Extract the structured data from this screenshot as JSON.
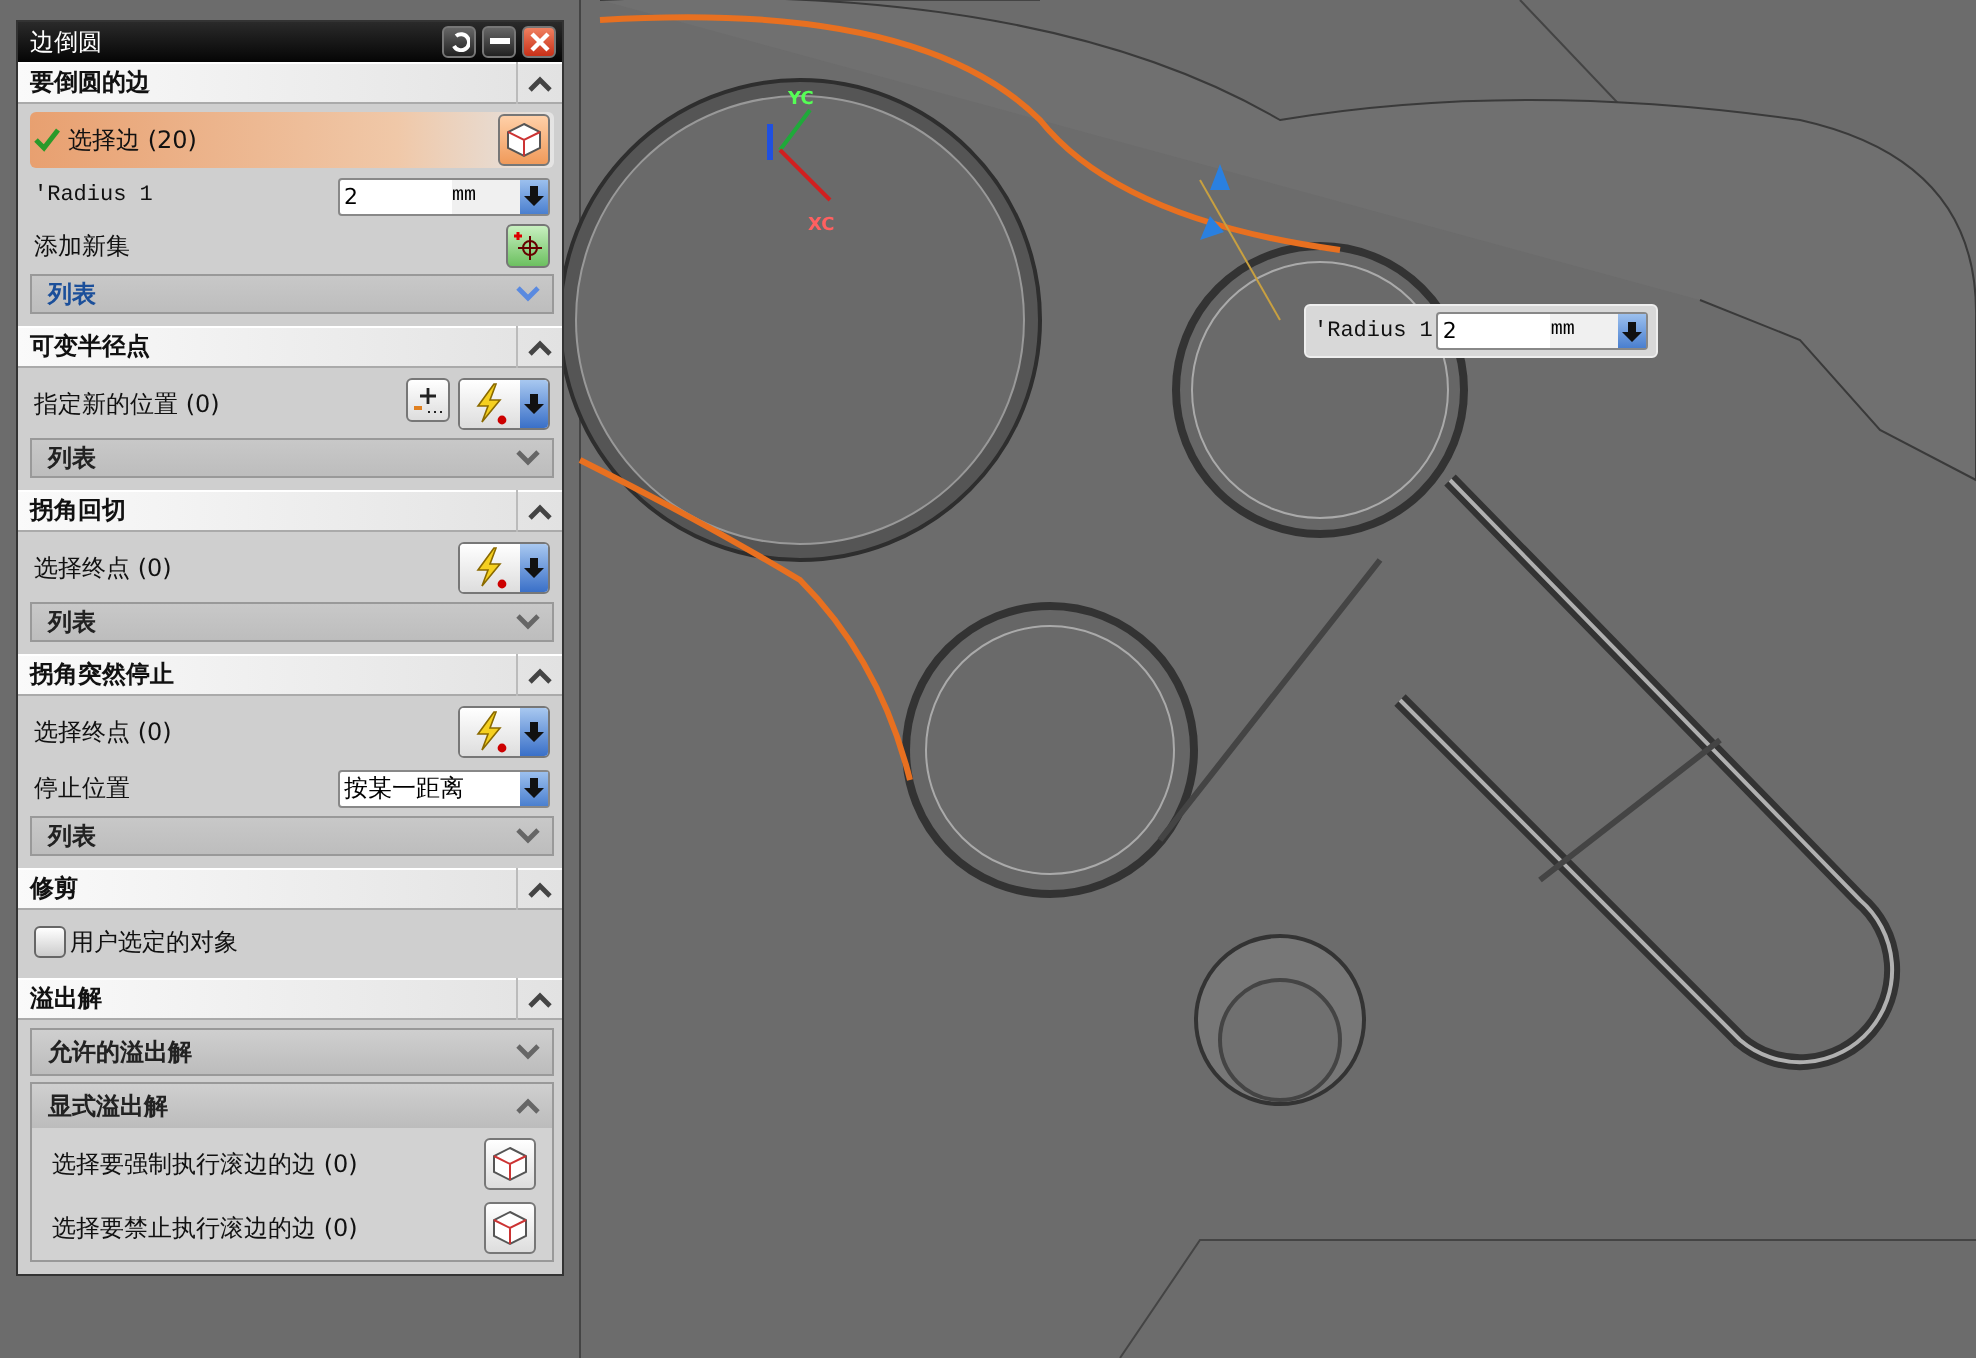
{
  "dialog": {
    "title": "边倒圆"
  },
  "sections": [
    {
      "title": "要倒圆的边",
      "expanded": true,
      "rows": [
        {
          "kind": "select",
          "label": "选择边 (20)",
          "active": true,
          "checked": true
        },
        {
          "kind": "value",
          "label": "'Radius 1",
          "value": "2",
          "unit": "mm"
        },
        {
          "kind": "add",
          "label": "添加新集"
        },
        {
          "kind": "list",
          "label": "列表",
          "highlighted": true
        }
      ]
    },
    {
      "title": "可变半径点",
      "expanded": true,
      "rows": [
        {
          "kind": "point",
          "label": "指定新的位置 (0)"
        },
        {
          "kind": "list",
          "label": "列表",
          "highlighted": false
        }
      ]
    },
    {
      "title": "拐角回切",
      "expanded": true,
      "rows": [
        {
          "kind": "snap",
          "label": "选择终点 (0)"
        },
        {
          "kind": "list",
          "label": "列表",
          "highlighted": false
        }
      ]
    },
    {
      "title": "拐角突然停止",
      "expanded": true,
      "rows": [
        {
          "kind": "snap",
          "label": "选择终点 (0)"
        },
        {
          "kind": "dropdown",
          "label": "停止位置",
          "value": "按某一距离"
        },
        {
          "kind": "list",
          "label": "列表",
          "highlighted": false
        }
      ]
    },
    {
      "title": "修剪",
      "expanded": true,
      "rows": [
        {
          "kind": "checkbox",
          "label": "用户选定的对象",
          "checked": false
        }
      ]
    },
    {
      "title": "溢出解",
      "expanded": true,
      "rows": [
        {
          "kind": "group",
          "label": "允许的溢出解",
          "expanded": false,
          "rows": []
        },
        {
          "kind": "group",
          "label": "显式溢出解",
          "expanded": true,
          "rows": [
            {
              "kind": "select",
              "label": "选择要强制执行滚边的边 (0)",
              "active": false,
              "checked": false
            },
            {
              "kind": "select",
              "label": "选择要禁止执行滚边的边 (0)",
              "active": false,
              "checked": false
            }
          ]
        }
      ]
    }
  ],
  "axis_labels": [
    "YC",
    "XC"
  ],
  "screen_field": {
    "label": "'Radius 1",
    "value": "2",
    "unit": "mm"
  }
}
